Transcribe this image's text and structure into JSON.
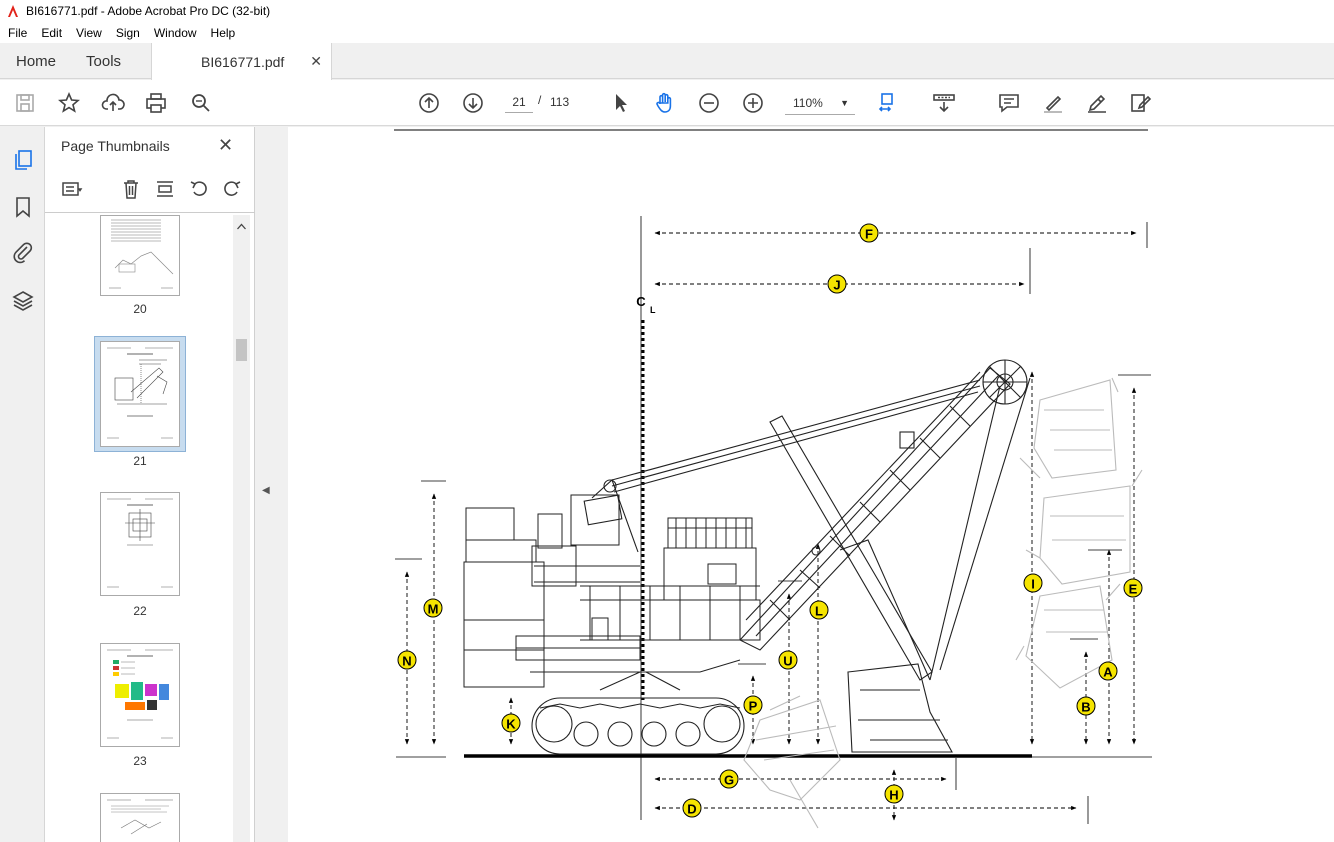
{
  "window": {
    "title": "BI616771.pdf - Adobe Acrobat Pro DC (32-bit)"
  },
  "menu": {
    "items": [
      "File",
      "Edit",
      "View",
      "Sign",
      "Window",
      "Help"
    ]
  },
  "tabs": {
    "home": "Home",
    "tools": "Tools",
    "document": "BI616771.pdf"
  },
  "toolbar": {
    "current_page": "21",
    "page_separator": "/",
    "total_pages": "113",
    "zoom": "110%",
    "icons": [
      "save-icon",
      "star-icon",
      "upload-icon",
      "print-icon",
      "find-icon",
      "page-up-icon",
      "page-down-icon",
      "select-cursor-icon",
      "hand-icon",
      "zoom-out-icon",
      "zoom-in-icon",
      "fit-page-icon",
      "scroll-mode-icon",
      "comment-icon",
      "highlight-icon",
      "sign-icon",
      "edit-pdf-icon"
    ]
  },
  "sidebar": {
    "panel_title": "Page Thumbnails",
    "thumbnails": [
      {
        "label": "20",
        "selected": false
      },
      {
        "label": "21",
        "selected": true
      },
      {
        "label": "22",
        "selected": false
      },
      {
        "label": "23",
        "selected": false
      }
    ]
  },
  "drawing": {
    "dimension_labels": [
      "F",
      "J",
      "M",
      "N",
      "K",
      "L",
      "U",
      "P",
      "G",
      "D",
      "H",
      "I",
      "E",
      "A",
      "B"
    ],
    "centerline_symbol": "C",
    "centerline_sub": "L"
  },
  "colors": {
    "accent": "#1a73e8",
    "label_fill": "#f5e400",
    "selected_thumb": "#c7dcef"
  }
}
